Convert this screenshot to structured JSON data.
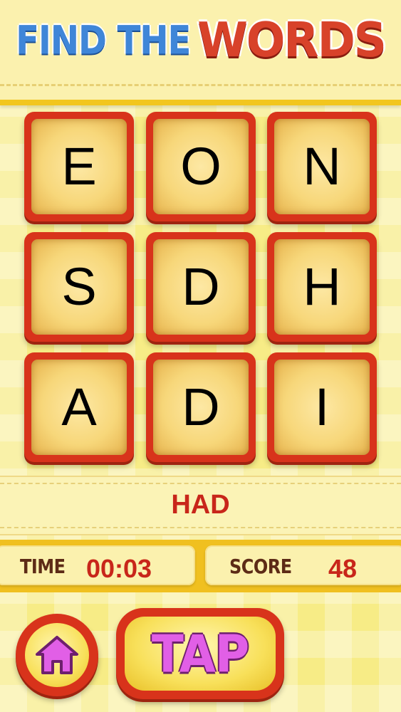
{
  "header": {
    "title_find": "FIND THE",
    "title_words": "WORDS"
  },
  "grid": {
    "rows": [
      [
        "E",
        "O",
        "N"
      ],
      [
        "S",
        "D",
        "H"
      ],
      [
        "A",
        "D",
        "I"
      ]
    ]
  },
  "current_word": "HAD",
  "stats": {
    "time_label": "TIME",
    "time_value": "00:03",
    "score_label": "SCORE",
    "score_value": "48"
  },
  "buttons": {
    "home_icon": "home-icon",
    "tap_label": "TAP"
  },
  "colors": {
    "tile_border": "#d8331b",
    "tile_face": "#f7d77a",
    "current_word": "#c8261a",
    "title_find": "#3f86d8",
    "title_words": "#d8422a",
    "tap_text": "#e15fe6",
    "background": "#f7ec86"
  }
}
